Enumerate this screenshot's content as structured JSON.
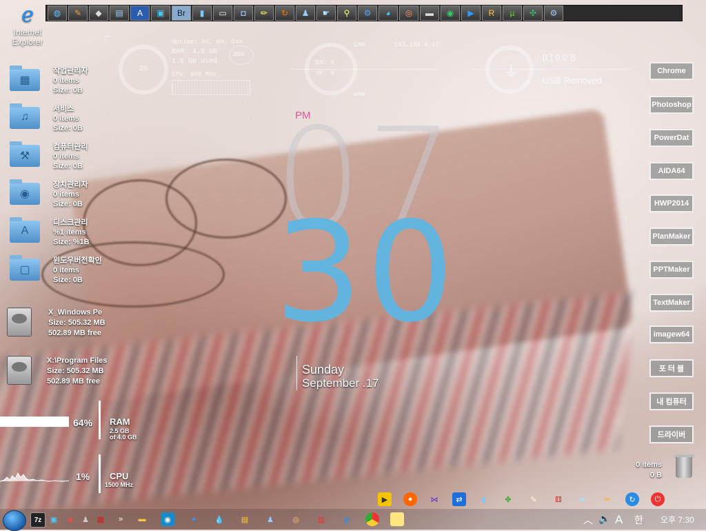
{
  "desktop": {
    "ie_label": "Internet Explorer",
    "folders": [
      {
        "name": "작업관리자",
        "items": "0 items",
        "size": "Size: 0B",
        "glyph": "▦"
      },
      {
        "name": "서비스",
        "items": "0 items",
        "size": "Size: 0B",
        "glyph": "♫"
      },
      {
        "name": "컴퓨터관리",
        "items": "0 items",
        "size": "Size: 0B",
        "glyph": "⚒"
      },
      {
        "name": "장치관리자",
        "items": "0 items",
        "size": "Size: 0B",
        "glyph": "◉"
      },
      {
        "name": "디스크관리",
        "items": "%1 items",
        "size": "Size: %1B",
        "glyph": "A"
      },
      {
        "name": "윈도우버전확인",
        "items": "0 items",
        "size": "Size: 0B",
        "glyph": "▢"
      }
    ],
    "drives": [
      {
        "name": "X_Windows Pe",
        "size": "Size: 505.32 MB",
        "free": "502.89 MB free"
      },
      {
        "name": "X:\\Program Files",
        "size": "Size: 505.32 MB",
        "free": "502.89 MB free"
      }
    ]
  },
  "meters": {
    "ram": {
      "percent_text": "64%",
      "fill": 0.64,
      "label": "RAM",
      "detail1": "2.5 GB",
      "detail2": "of 4.0 GB"
    },
    "cpu": {
      "percent_text": "1%",
      "label": "CPU",
      "detail1": "1500 MHz"
    }
  },
  "hud": {
    "cpu_ring_percent": "2%",
    "uptime": "Uptime:  0d, 0h, 04m",
    "ram_line": "RAM: 4.0 GB",
    "ram_used": "1.5 GB used",
    "ram_ring": "36%",
    "cpu_line": "CPU: 800 MHz",
    "lan_label": "LAN",
    "lan_ip": "192.168.0.17",
    "dn": "DN: 0",
    "up": "UP: 0",
    "wan_label": "WAN",
    "usb_title": "[I:] 0.0 B",
    "usb_status": "USB Removed"
  },
  "clock": {
    "ampm": "PM",
    "hour": "07",
    "minute": "30",
    "day": "Sunday",
    "date": "September .17"
  },
  "right_buttons": [
    "Chrome",
    "Photoshop",
    "PowerDat",
    "AIDA64",
    "HWP2014",
    "PlanMaker",
    "PPTMaker",
    "TextMaker",
    "imagew64",
    "포 터 블",
    "내 컴퓨터",
    "드라이버"
  ],
  "recycle": {
    "items": "0 items",
    "size": "0 B"
  },
  "taskbar": {
    "sevenzip": "7z",
    "chevron": "»",
    "tray_letter": "A",
    "ime": "한",
    "clock": "오후 7:30"
  }
}
